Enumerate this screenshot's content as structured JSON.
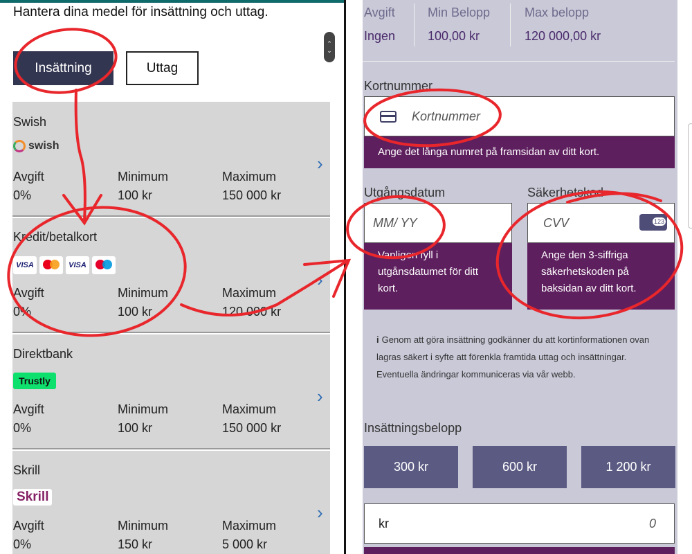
{
  "left": {
    "description": "Hantera dina medel för insättning och uttag.",
    "tabs": {
      "deposit": "Insättning",
      "withdraw": "Uttag"
    },
    "scroll_icons": {
      "up": "⌃",
      "down": "⌄"
    },
    "methods": [
      {
        "name": "Swish",
        "logo_text": "swish",
        "fee_label": "Avgift",
        "fee": "0%",
        "min_label": "Minimum",
        "min": "100 kr",
        "max_label": "Maximum",
        "max": "150 000 kr"
      },
      {
        "name": "Kredit/betalkort",
        "logo_text": "VISA",
        "fee_label": "Avgift",
        "fee": "0%",
        "min_label": "Minimum",
        "min": "100 kr",
        "max_label": "Maximum",
        "max": "120 000 kr"
      },
      {
        "name": "Direktbank",
        "logo_text": "Trustly",
        "fee_label": "Avgift",
        "fee": "0%",
        "min_label": "Minimum",
        "min": "100 kr",
        "max_label": "Maximum",
        "max": "150 000 kr"
      },
      {
        "name": "Skrill",
        "logo_text": "Skrill",
        "fee_label": "Avgift",
        "fee": "0%",
        "min_label": "Minimum",
        "min": "150 kr",
        "max_label": "Maximum",
        "max": "5 000 kr"
      }
    ],
    "card_logos": [
      "VISA",
      "mastercard",
      "VISA",
      "maestro"
    ],
    "chevron": "›"
  },
  "right": {
    "summary": {
      "fee_label": "Avgift",
      "fee": "Ingen",
      "min_label": "Min Belopp",
      "min": "100,00 kr",
      "max_label": "Max belopp",
      "max": "120 000,00 kr"
    },
    "card_number": {
      "label": "Kortnummer",
      "placeholder": "Kortnummer",
      "hint": "Ange det långa numret på framsidan av ditt kort."
    },
    "expiry": {
      "label": "Utgångsdatum",
      "placeholder": "MM/ YY",
      "hint": "Vanligen fyll i utgånsdatumet för ditt kort."
    },
    "cvv": {
      "label": "Säkerhetskod",
      "placeholder": "CVV",
      "icon_text": "123",
      "hint": "Ange den 3-siffriga säkerhetskoden på baksidan av ditt kort."
    },
    "info": {
      "icon": "i",
      "text": "Genom att göra insättning godkänner du att kortinformationen ovan lagras säkert i syfte att förenkla framtida uttag och insättningar. Eventuella ändringar kommuniceras via vår webb."
    },
    "amount": {
      "label": "Insättningsbelopp",
      "presets": [
        "300 kr",
        "600 kr",
        "1 200 kr"
      ],
      "currency": "kr",
      "value": "0"
    }
  },
  "colors": {
    "accent_dark": "#333651",
    "hint_purple": "#5e1f5e",
    "panel_lavender": "#c9c9d8",
    "annotation_red": "#e8262b"
  }
}
